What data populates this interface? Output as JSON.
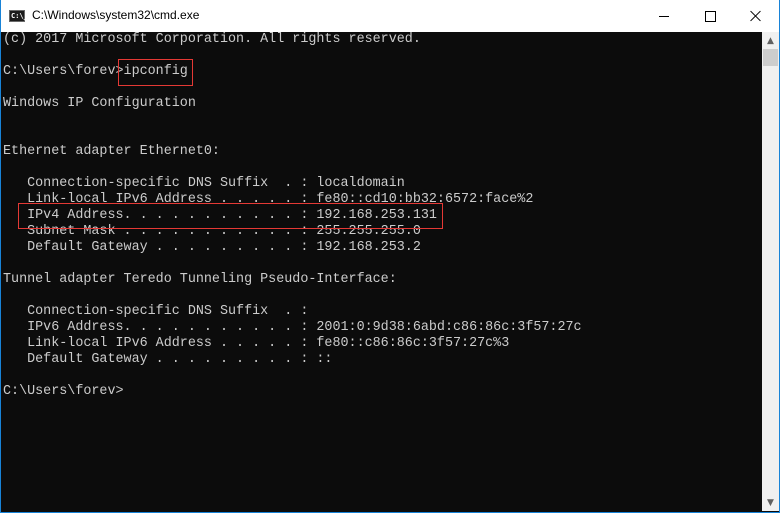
{
  "window": {
    "title": "C:\\Windows\\system32\\cmd.exe",
    "icon": "cmd-icon",
    "controls": {
      "minimize": "minimize-icon",
      "maximize": "maximize-icon",
      "close": "close-icon"
    }
  },
  "console": {
    "lines": [
      "(c) 2017 Microsoft Corporation. All rights reserved.",
      "",
      "C:\\Users\\forev>ipconfig",
      "",
      "Windows IP Configuration",
      "",
      "",
      "Ethernet adapter Ethernet0:",
      "",
      "   Connection-specific DNS Suffix  . : localdomain",
      "   Link-local IPv6 Address . . . . . : fe80::cd10:bb32:6572:face%2",
      "   IPv4 Address. . . . . . . . . . . : 192.168.253.131",
      "   Subnet Mask . . . . . . . . . . . : 255.255.255.0",
      "   Default Gateway . . . . . . . . . : 192.168.253.2",
      "",
      "Tunnel adapter Teredo Tunneling Pseudo-Interface:",
      "",
      "   Connection-specific DNS Suffix  . :",
      "   IPv6 Address. . . . . . . . . . . : 2001:0:9d38:6abd:c86:86c:3f57:27c",
      "   Link-local IPv6 Address . . . . . : fe80::c86:86c:3f57:27c%3",
      "   Default Gateway . . . . . . . . . : ::",
      "",
      "C:\\Users\\forev>"
    ],
    "highlights": [
      "ipconfig command",
      "IPv4 Address line"
    ]
  },
  "colors": {
    "console_bg": "#0c0c0c",
    "console_fg": "#cccccc",
    "highlight": "#e53935",
    "window_border": "#1883d7"
  }
}
